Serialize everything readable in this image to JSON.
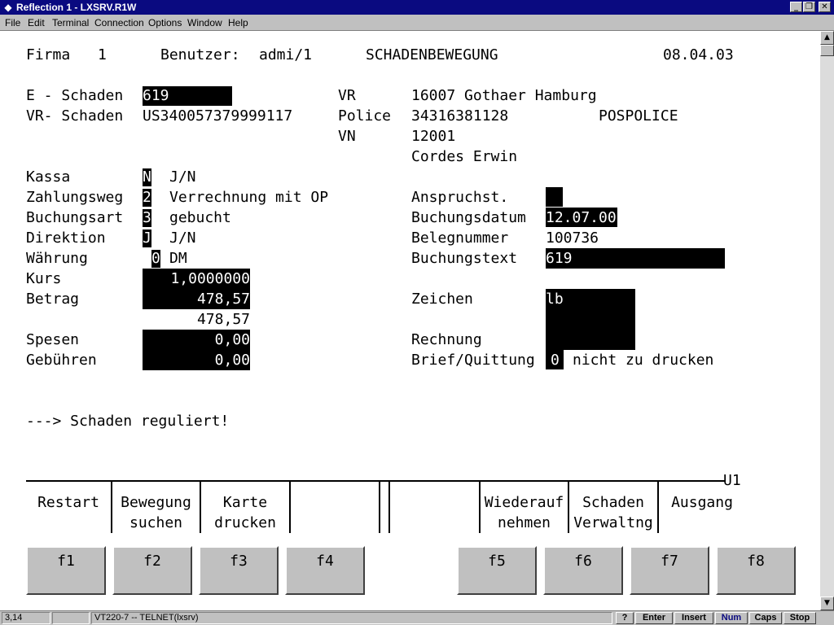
{
  "window": {
    "title": "Reflection 1 - LXSRV.R1W",
    "minimize": "_",
    "restore": "❐",
    "close": "✕"
  },
  "menu": [
    "File",
    "Edit",
    "Terminal",
    "Connection",
    "Options",
    "Window",
    "Help"
  ],
  "header": {
    "firma_label": "Firma",
    "firma_value": "1",
    "benutzer_label": "Benutzer:",
    "benutzer_value": "admi/1",
    "screen_title": "SCHADENBEWEGUNG",
    "date": "08.04.03"
  },
  "claim": {
    "e_schaden_label": "E - Schaden",
    "e_schaden_value": "619",
    "vr_schaden_label": "VR- Schaden",
    "vr_schaden_value": "US340057379999117",
    "vr_label": "VR",
    "vr_value": "16007 Gothaer Hamburg",
    "police_label": "Police",
    "police_value": "34316381128",
    "police_type": "POSPOLICE",
    "vn_label": "VN",
    "vn_value": "12001",
    "vn_name": "Cordes Erwin"
  },
  "fields": {
    "kassa_label": "Kassa",
    "kassa_value": "N",
    "kassa_hint": "J/N",
    "zahlungsweg_label": "Zahlungsweg",
    "zahlungsweg_value": "2",
    "zahlungsweg_text": "Verrechnung mit OP",
    "buchungsart_label": "Buchungsart",
    "buchungsart_value": "3",
    "buchungsart_text": "gebucht",
    "direktion_label": "Direktion",
    "direktion_value": "J",
    "direktion_hint": "J/N",
    "waehrung_label": "Währung",
    "waehrung_value": "0",
    "waehrung_text": "DM",
    "kurs_label": "Kurs",
    "kurs_value": "1,0000000",
    "betrag_label": "Betrag",
    "betrag_value": "478,57",
    "betrag_sum": "478,57",
    "spesen_label": "Spesen",
    "spesen_value": "0,00",
    "gebuehren_label": "Gebühren",
    "gebuehren_value": "0,00",
    "anspruchst_label": "Anspruchst.",
    "anspruchst_value": "",
    "buchungsdatum_label": "Buchungsdatum",
    "buchungsdatum_value": "12.07.00",
    "belegnummer_label": "Belegnummer",
    "belegnummer_value": "100736",
    "buchungstext_label": "Buchungstext",
    "buchungstext_value": "619",
    "zeichen_label": "Zeichen",
    "zeichen_value": "lb",
    "rechnung_label": "Rechnung",
    "brief_label": "Brief/Quittung",
    "brief_value": "0",
    "brief_text": "nicht zu drucken"
  },
  "message": "---> Schaden reguliert!",
  "panel_id": "U1",
  "function_labels": [
    {
      "line1": "Restart",
      "line2": ""
    },
    {
      "line1": "Bewegung",
      "line2": "suchen"
    },
    {
      "line1": "Karte",
      "line2": "drucken"
    },
    {
      "line1": "",
      "line2": ""
    },
    {
      "line1": "",
      "line2": ""
    },
    {
      "line1": "Wiederauf",
      "line2": "nehmen"
    },
    {
      "line1": "Schaden",
      "line2": "Verwaltng"
    },
    {
      "line1": "Ausgang",
      "line2": ""
    }
  ],
  "function_keys": [
    "f1",
    "f2",
    "f3",
    "f4",
    "f5",
    "f6",
    "f7",
    "f8"
  ],
  "status": {
    "cursor": "3,14",
    "empty": "",
    "session": "VT220-7 -- TELNET(lxsrv)",
    "help": "?",
    "enter": "Enter",
    "insert": "Insert",
    "num": "Num",
    "caps": "Caps",
    "stop": "Stop"
  },
  "colors": {
    "titlebar": "#0a0a80",
    "chrome": "#c0c0c0",
    "field_fill": "#000000",
    "num_indicator": "#0a0a80"
  }
}
